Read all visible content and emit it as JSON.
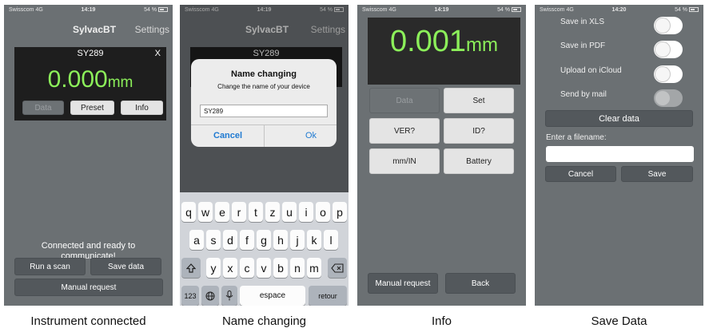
{
  "status_bar": {
    "carrier": "Swisscom 4G",
    "times": [
      "14:19",
      "14:20",
      "14:19",
      "14:20"
    ],
    "battery": "54 %"
  },
  "screens": {
    "instrument_connected": {
      "app_title": "SylvacBT",
      "settings": "Settings",
      "device_name": "SY289",
      "close": "X",
      "value": "0.000",
      "unit": "mm",
      "buttons": {
        "data": "Data",
        "preset": "Preset",
        "info": "Info"
      },
      "status_text": "Connected and ready to communicate!",
      "run_scan": "Run a scan",
      "save_data": "Save data",
      "manual_request": "Manual request",
      "caption": "Instrument connected"
    },
    "name_changing": {
      "app_title": "SylvacBT",
      "settings": "Settings",
      "device_name": "SY289",
      "dialog_title": "Name changing",
      "dialog_subtitle": "Change the name of your device",
      "input_value": "SY289",
      "cancel": "Cancel",
      "ok": "Ok",
      "keyboard": {
        "row1": [
          "q",
          "w",
          "e",
          "r",
          "t",
          "z",
          "u",
          "i",
          "o",
          "p"
        ],
        "row2": [
          "a",
          "s",
          "d",
          "f",
          "g",
          "h",
          "j",
          "k",
          "l"
        ],
        "row3": [
          "y",
          "x",
          "c",
          "v",
          "b",
          "n",
          "m"
        ],
        "numbers": "123",
        "space": "espace",
        "return": "retour"
      },
      "caption": "Name changing"
    },
    "info": {
      "value": "0.001",
      "unit": "mm",
      "buttons": {
        "data": "Data",
        "set": "Set",
        "ver": "VER?",
        "id": "ID?",
        "mm_in": "mm/IN",
        "battery": "Battery"
      },
      "manual_request": "Manual request",
      "back": "Back",
      "caption": "Info"
    },
    "save_data": {
      "options": {
        "xls": "Save in XLS",
        "pdf": "Save in PDF",
        "icloud": "Upload on iCloud",
        "mail": "Send by mail"
      },
      "toggle_states": {
        "xls": false,
        "pdf": false,
        "icloud": false,
        "mail": false
      },
      "mail_enabled": false,
      "clear_data": "Clear data",
      "filename_label": "Enter a filename:",
      "filename_value": "",
      "cancel": "Cancel",
      "save": "Save",
      "caption": "Save Data"
    }
  },
  "colors": {
    "accent_green": "#8cf05a",
    "phone_bg": "#6b7073",
    "button_dark": "#53585c",
    "button_light": "#e4e4e4",
    "dialog_blue": "#1f7ad1"
  }
}
